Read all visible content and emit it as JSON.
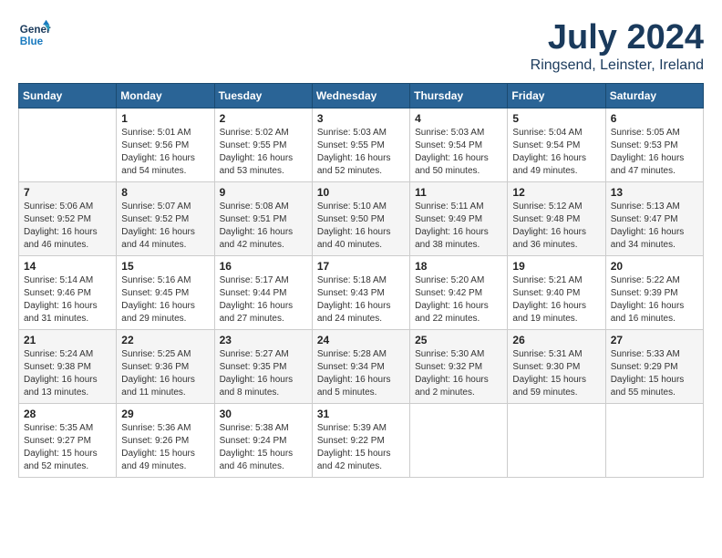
{
  "header": {
    "logo_line1": "General",
    "logo_line2": "Blue",
    "month": "July 2024",
    "location": "Ringsend, Leinster, Ireland"
  },
  "weekdays": [
    "Sunday",
    "Monday",
    "Tuesday",
    "Wednesday",
    "Thursday",
    "Friday",
    "Saturday"
  ],
  "weeks": [
    [
      {
        "day": "",
        "info": ""
      },
      {
        "day": "1",
        "info": "Sunrise: 5:01 AM\nSunset: 9:56 PM\nDaylight: 16 hours\nand 54 minutes."
      },
      {
        "day": "2",
        "info": "Sunrise: 5:02 AM\nSunset: 9:55 PM\nDaylight: 16 hours\nand 53 minutes."
      },
      {
        "day": "3",
        "info": "Sunrise: 5:03 AM\nSunset: 9:55 PM\nDaylight: 16 hours\nand 52 minutes."
      },
      {
        "day": "4",
        "info": "Sunrise: 5:03 AM\nSunset: 9:54 PM\nDaylight: 16 hours\nand 50 minutes."
      },
      {
        "day": "5",
        "info": "Sunrise: 5:04 AM\nSunset: 9:54 PM\nDaylight: 16 hours\nand 49 minutes."
      },
      {
        "day": "6",
        "info": "Sunrise: 5:05 AM\nSunset: 9:53 PM\nDaylight: 16 hours\nand 47 minutes."
      }
    ],
    [
      {
        "day": "7",
        "info": "Sunrise: 5:06 AM\nSunset: 9:52 PM\nDaylight: 16 hours\nand 46 minutes."
      },
      {
        "day": "8",
        "info": "Sunrise: 5:07 AM\nSunset: 9:52 PM\nDaylight: 16 hours\nand 44 minutes."
      },
      {
        "day": "9",
        "info": "Sunrise: 5:08 AM\nSunset: 9:51 PM\nDaylight: 16 hours\nand 42 minutes."
      },
      {
        "day": "10",
        "info": "Sunrise: 5:10 AM\nSunset: 9:50 PM\nDaylight: 16 hours\nand 40 minutes."
      },
      {
        "day": "11",
        "info": "Sunrise: 5:11 AM\nSunset: 9:49 PM\nDaylight: 16 hours\nand 38 minutes."
      },
      {
        "day": "12",
        "info": "Sunrise: 5:12 AM\nSunset: 9:48 PM\nDaylight: 16 hours\nand 36 minutes."
      },
      {
        "day": "13",
        "info": "Sunrise: 5:13 AM\nSunset: 9:47 PM\nDaylight: 16 hours\nand 34 minutes."
      }
    ],
    [
      {
        "day": "14",
        "info": "Sunrise: 5:14 AM\nSunset: 9:46 PM\nDaylight: 16 hours\nand 31 minutes."
      },
      {
        "day": "15",
        "info": "Sunrise: 5:16 AM\nSunset: 9:45 PM\nDaylight: 16 hours\nand 29 minutes."
      },
      {
        "day": "16",
        "info": "Sunrise: 5:17 AM\nSunset: 9:44 PM\nDaylight: 16 hours\nand 27 minutes."
      },
      {
        "day": "17",
        "info": "Sunrise: 5:18 AM\nSunset: 9:43 PM\nDaylight: 16 hours\nand 24 minutes."
      },
      {
        "day": "18",
        "info": "Sunrise: 5:20 AM\nSunset: 9:42 PM\nDaylight: 16 hours\nand 22 minutes."
      },
      {
        "day": "19",
        "info": "Sunrise: 5:21 AM\nSunset: 9:40 PM\nDaylight: 16 hours\nand 19 minutes."
      },
      {
        "day": "20",
        "info": "Sunrise: 5:22 AM\nSunset: 9:39 PM\nDaylight: 16 hours\nand 16 minutes."
      }
    ],
    [
      {
        "day": "21",
        "info": "Sunrise: 5:24 AM\nSunset: 9:38 PM\nDaylight: 16 hours\nand 13 minutes."
      },
      {
        "day": "22",
        "info": "Sunrise: 5:25 AM\nSunset: 9:36 PM\nDaylight: 16 hours\nand 11 minutes."
      },
      {
        "day": "23",
        "info": "Sunrise: 5:27 AM\nSunset: 9:35 PM\nDaylight: 16 hours\nand 8 minutes."
      },
      {
        "day": "24",
        "info": "Sunrise: 5:28 AM\nSunset: 9:34 PM\nDaylight: 16 hours\nand 5 minutes."
      },
      {
        "day": "25",
        "info": "Sunrise: 5:30 AM\nSunset: 9:32 PM\nDaylight: 16 hours\nand 2 minutes."
      },
      {
        "day": "26",
        "info": "Sunrise: 5:31 AM\nSunset: 9:30 PM\nDaylight: 15 hours\nand 59 minutes."
      },
      {
        "day": "27",
        "info": "Sunrise: 5:33 AM\nSunset: 9:29 PM\nDaylight: 15 hours\nand 55 minutes."
      }
    ],
    [
      {
        "day": "28",
        "info": "Sunrise: 5:35 AM\nSunset: 9:27 PM\nDaylight: 15 hours\nand 52 minutes."
      },
      {
        "day": "29",
        "info": "Sunrise: 5:36 AM\nSunset: 9:26 PM\nDaylight: 15 hours\nand 49 minutes."
      },
      {
        "day": "30",
        "info": "Sunrise: 5:38 AM\nSunset: 9:24 PM\nDaylight: 15 hours\nand 46 minutes."
      },
      {
        "day": "31",
        "info": "Sunrise: 5:39 AM\nSunset: 9:22 PM\nDaylight: 15 hours\nand 42 minutes."
      },
      {
        "day": "",
        "info": ""
      },
      {
        "day": "",
        "info": ""
      },
      {
        "day": "",
        "info": ""
      }
    ]
  ]
}
